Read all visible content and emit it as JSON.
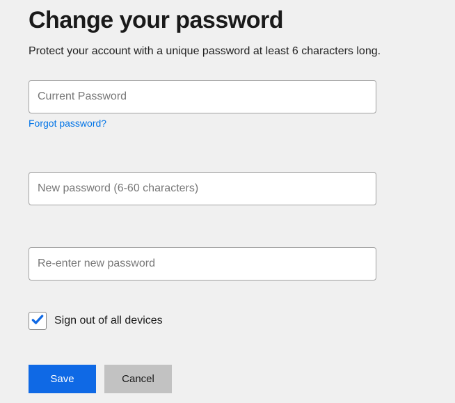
{
  "header": {
    "title": "Change your password",
    "subtitle": "Protect your account with a unique password at least 6 characters long."
  },
  "fields": {
    "current_password": {
      "placeholder": "Current Password",
      "value": ""
    },
    "forgot_link": "Forgot password?",
    "new_password": {
      "placeholder": "New password (6-60 characters)",
      "value": ""
    },
    "confirm_password": {
      "placeholder": "Re-enter new password",
      "value": ""
    }
  },
  "checkbox": {
    "label": "Sign out of all devices",
    "checked": true
  },
  "buttons": {
    "save": "Save",
    "cancel": "Cancel"
  },
  "colors": {
    "primary": "#0f69e5",
    "link": "#0073e6",
    "secondary_button": "#c2c2c2",
    "background": "#f0f0f0"
  }
}
